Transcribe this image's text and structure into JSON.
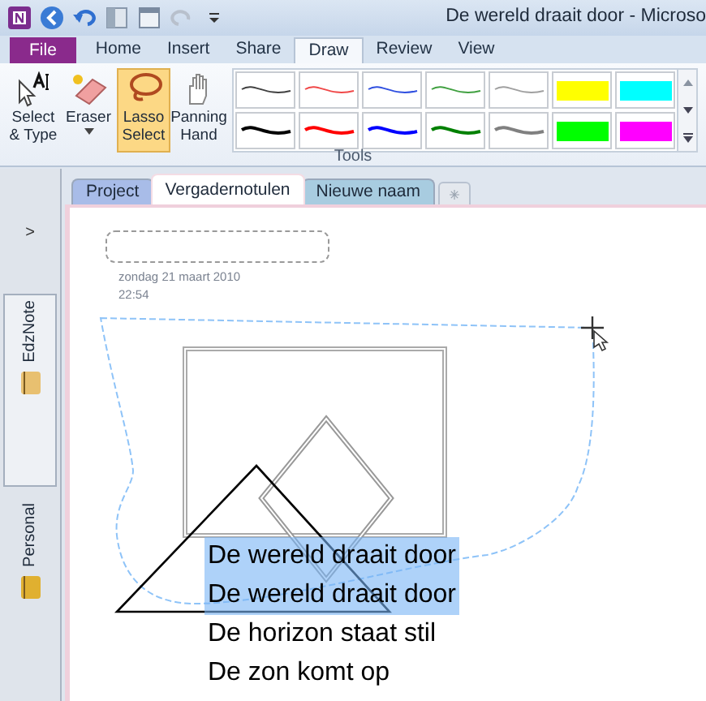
{
  "window": {
    "title": "De wereld draait door - Microso"
  },
  "ribbon_tabs": [
    {
      "label": "File",
      "kind": "file",
      "selected": false
    },
    {
      "label": "Home",
      "kind": "tab",
      "selected": false
    },
    {
      "label": "Insert",
      "kind": "tab",
      "selected": false
    },
    {
      "label": "Share",
      "kind": "tab",
      "selected": false
    },
    {
      "label": "Draw",
      "kind": "tab",
      "selected": true
    },
    {
      "label": "Review",
      "kind": "tab",
      "selected": false
    },
    {
      "label": "View",
      "kind": "tab",
      "selected": false
    }
  ],
  "tools": [
    {
      "label": "Select & Type",
      "kind": "select",
      "selected": false,
      "dropdown": false
    },
    {
      "label": "Eraser",
      "kind": "eraser",
      "selected": false,
      "dropdown": true
    },
    {
      "label": "Lasso Select",
      "kind": "lasso",
      "selected": true,
      "dropdown": false
    },
    {
      "label": "Panning Hand",
      "kind": "hand",
      "selected": false,
      "dropdown": false
    }
  ],
  "pens": [
    {
      "kind": "thin",
      "color": "#404040"
    },
    {
      "kind": "thin",
      "color": "#f04848"
    },
    {
      "kind": "thin",
      "color": "#3050e0"
    },
    {
      "kind": "thin",
      "color": "#40a040"
    },
    {
      "kind": "thin",
      "color": "#a0a0a0"
    },
    {
      "kind": "highlighter",
      "color": "#ffff00"
    },
    {
      "kind": "highlighter",
      "color": "#00ffff"
    },
    {
      "kind": "thick",
      "color": "#000000"
    },
    {
      "kind": "thick",
      "color": "#ff0000"
    },
    {
      "kind": "thick",
      "color": "#0000ff"
    },
    {
      "kind": "thick",
      "color": "#008000"
    },
    {
      "kind": "thick",
      "color": "#808080"
    },
    {
      "kind": "highlighter",
      "color": "#00ff00"
    },
    {
      "kind": "highlighter",
      "color": "#ff00ff"
    }
  ],
  "group_label": "Tools",
  "notebooks": [
    {
      "name": "EdzNote",
      "selected": true,
      "color": "#e8c070"
    },
    {
      "name": "Personal",
      "selected": false,
      "color": "#e0b030"
    }
  ],
  "nav_expand": ">",
  "section_tabs": [
    {
      "label": "Project",
      "color": "#a8bce8",
      "selected": false
    },
    {
      "label": "Vergadernotulen",
      "color": "#f4dce4",
      "selected": true
    },
    {
      "label": "Nieuwe naam",
      "color": "#a8cce0",
      "selected": false
    }
  ],
  "page": {
    "date": "zondag 21 maart 2010",
    "time": "22:54",
    "lines": [
      {
        "text": "De wereld draait door",
        "selected": true
      },
      {
        "text": "De wereld draait door",
        "selected": true
      },
      {
        "text": "De horizon staat stil",
        "selected": false
      },
      {
        "text": "De zon komt op",
        "selected": false
      }
    ]
  }
}
